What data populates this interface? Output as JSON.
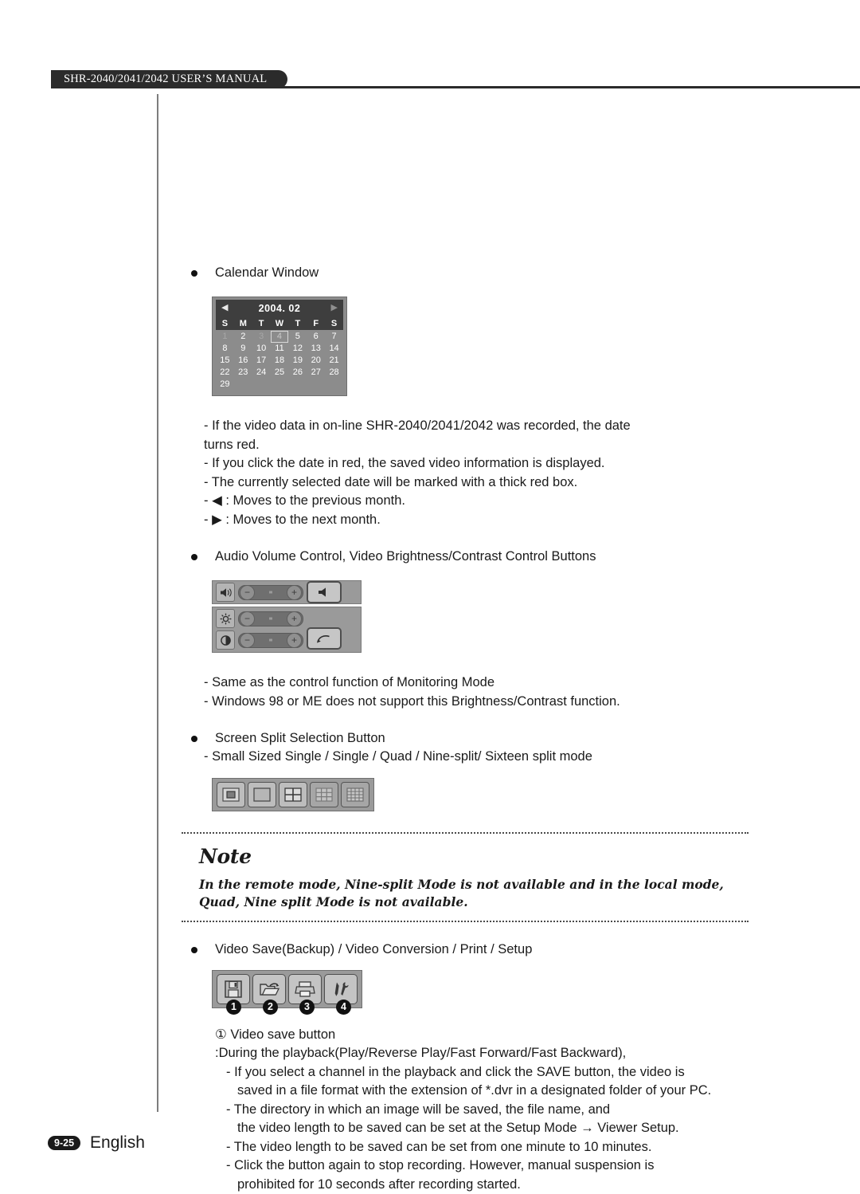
{
  "header": {
    "manual_title": "SHR-2040/2041/2042 USER’S MANUAL"
  },
  "sections": {
    "calendar": {
      "heading": "Calendar Window",
      "widget": {
        "prev_arrow": "◀",
        "next_arrow": "▶",
        "title": "2004.  02",
        "day_headers": [
          "S",
          "M",
          "T",
          "W",
          "T",
          "F",
          "S"
        ],
        "weeks": [
          [
            "1",
            "2",
            "3",
            "4",
            "5",
            "6",
            "7"
          ],
          [
            "8",
            "9",
            "10",
            "11",
            "12",
            "13",
            "14"
          ],
          [
            "15",
            "16",
            "17",
            "18",
            "19",
            "20",
            "21"
          ],
          [
            "22",
            "23",
            "24",
            "25",
            "26",
            "27",
            "28"
          ],
          [
            "29",
            "",
            "",
            "",
            "",
            "",
            ""
          ]
        ],
        "selected_day": "4",
        "muted_days": [
          "1",
          "3"
        ]
      },
      "notes": [
        "- If the video data in on-line SHR-2040/2041/2042 was recorded, the date",
        "turns red.",
        "- If you click the date in red, the saved video information is displayed.",
        "- The currently selected date will be marked with a thick red box.",
        "- ◀ : Moves to the previous month.",
        "- ▶ : Moves to the next month."
      ]
    },
    "av_control": {
      "heading": "Audio Volume Control, Video Brightness/Contrast Control Buttons",
      "controls": {
        "volume_icon": "speaker-icon",
        "brightness_icon": "brightness-icon",
        "contrast_icon": "contrast-icon",
        "minus_label": "−",
        "plus_label": "+",
        "mute_button_icon": "speaker-icon",
        "reset_button_icon": "reset-arrow-icon"
      },
      "notes": [
        "- Same as the control function of Monitoring Mode",
        "- Windows 98 or ME does not support this Brightness/Contrast function."
      ]
    },
    "screen_split": {
      "heading": "Screen Split Selection Button",
      "note": "- Small Sized Single / Single / Quad / Nine-split/ Sixteen split mode",
      "buttons": [
        {
          "name": "small-single-split-button",
          "mode": "small-single"
        },
        {
          "name": "single-split-button",
          "mode": "single"
        },
        {
          "name": "quad-split-button",
          "mode": "quad"
        },
        {
          "name": "nine-split-button",
          "mode": "nine"
        },
        {
          "name": "sixteen-split-button",
          "mode": "sixteen"
        }
      ]
    },
    "note_box": {
      "title": "Note",
      "body": "In the remote mode, Nine-split Mode is not available and in the local mode, Quad, Nine split Mode is not available."
    },
    "video_save": {
      "heading": "Video Save(Backup) / Video Conversion / Print / Setup",
      "buttons": [
        {
          "number": "1",
          "icon": "floppy-disk-icon",
          "label": "Video save button"
        },
        {
          "number": "2",
          "icon": "open-folder-icon",
          "label": "Video conversion button"
        },
        {
          "number": "3",
          "icon": "printer-icon",
          "label": "Print button"
        },
        {
          "number": "4",
          "icon": "tools-icon",
          "label": "Setup button"
        }
      ],
      "detail_title": "① Video save button",
      "detail_lines": [
        ":During the playback(Play/Reverse Play/Fast Forward/Fast Backward),",
        "- If you select a channel in the playback and click the SAVE button, the video is",
        "saved in a file format with the extension of *.dvr in a designated folder of your PC.",
        "- The directory in which an image will be saved, the file name, and",
        "the video length to be saved can be set at the Setup Mode → Viewer Setup.",
        "- The video length to be saved can be set from one minute to 10 minutes.",
        "- Click the button again to stop recording. However, manual suspension is",
        "prohibited for 10 seconds after recording started."
      ]
    }
  },
  "footer": {
    "page_number": "9-25",
    "language": "English"
  }
}
